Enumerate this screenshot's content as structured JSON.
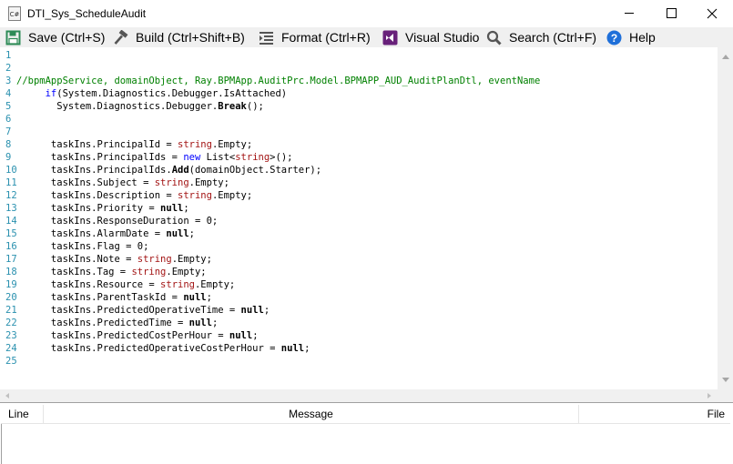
{
  "window": {
    "title": "DTI_Sys_ScheduleAudit",
    "icon_text": "C#"
  },
  "toolbar": {
    "save_label": "Save (Ctrl+S)",
    "build_label": "Build (Ctrl+Shift+B)",
    "format_label": "Format (Ctrl+R)",
    "vs_label": "Visual Studio",
    "search_label": "Search (Ctrl+F)",
    "help_label": "Help"
  },
  "editor": {
    "line_numbers": [
      "1",
      "2",
      "3",
      "4",
      "5",
      "6",
      "7",
      "8",
      "9",
      "10",
      "11",
      "12",
      "13",
      "14",
      "15",
      "16",
      "17",
      "18",
      "19",
      "20",
      "21",
      "22",
      "23",
      "24",
      "25"
    ]
  },
  "results": {
    "columns": {
      "line": "Line",
      "message": "Message",
      "file": "File"
    }
  },
  "colors": {
    "comment": "#008000",
    "keyword": "#0000ff",
    "string": "#a31515",
    "line_number": "#2b91af",
    "toolbar_bg": "#f0f0f0",
    "save_icon": "#2e8b57",
    "vs_icon": "#68217a",
    "help_icon": "#1e6fd9"
  },
  "icons": {
    "save": "floppy-disk-icon",
    "build": "hammer-icon",
    "format": "format-lines-icon",
    "vs": "visual-studio-icon",
    "search": "magnifier-icon",
    "help": "question-circle-icon"
  }
}
